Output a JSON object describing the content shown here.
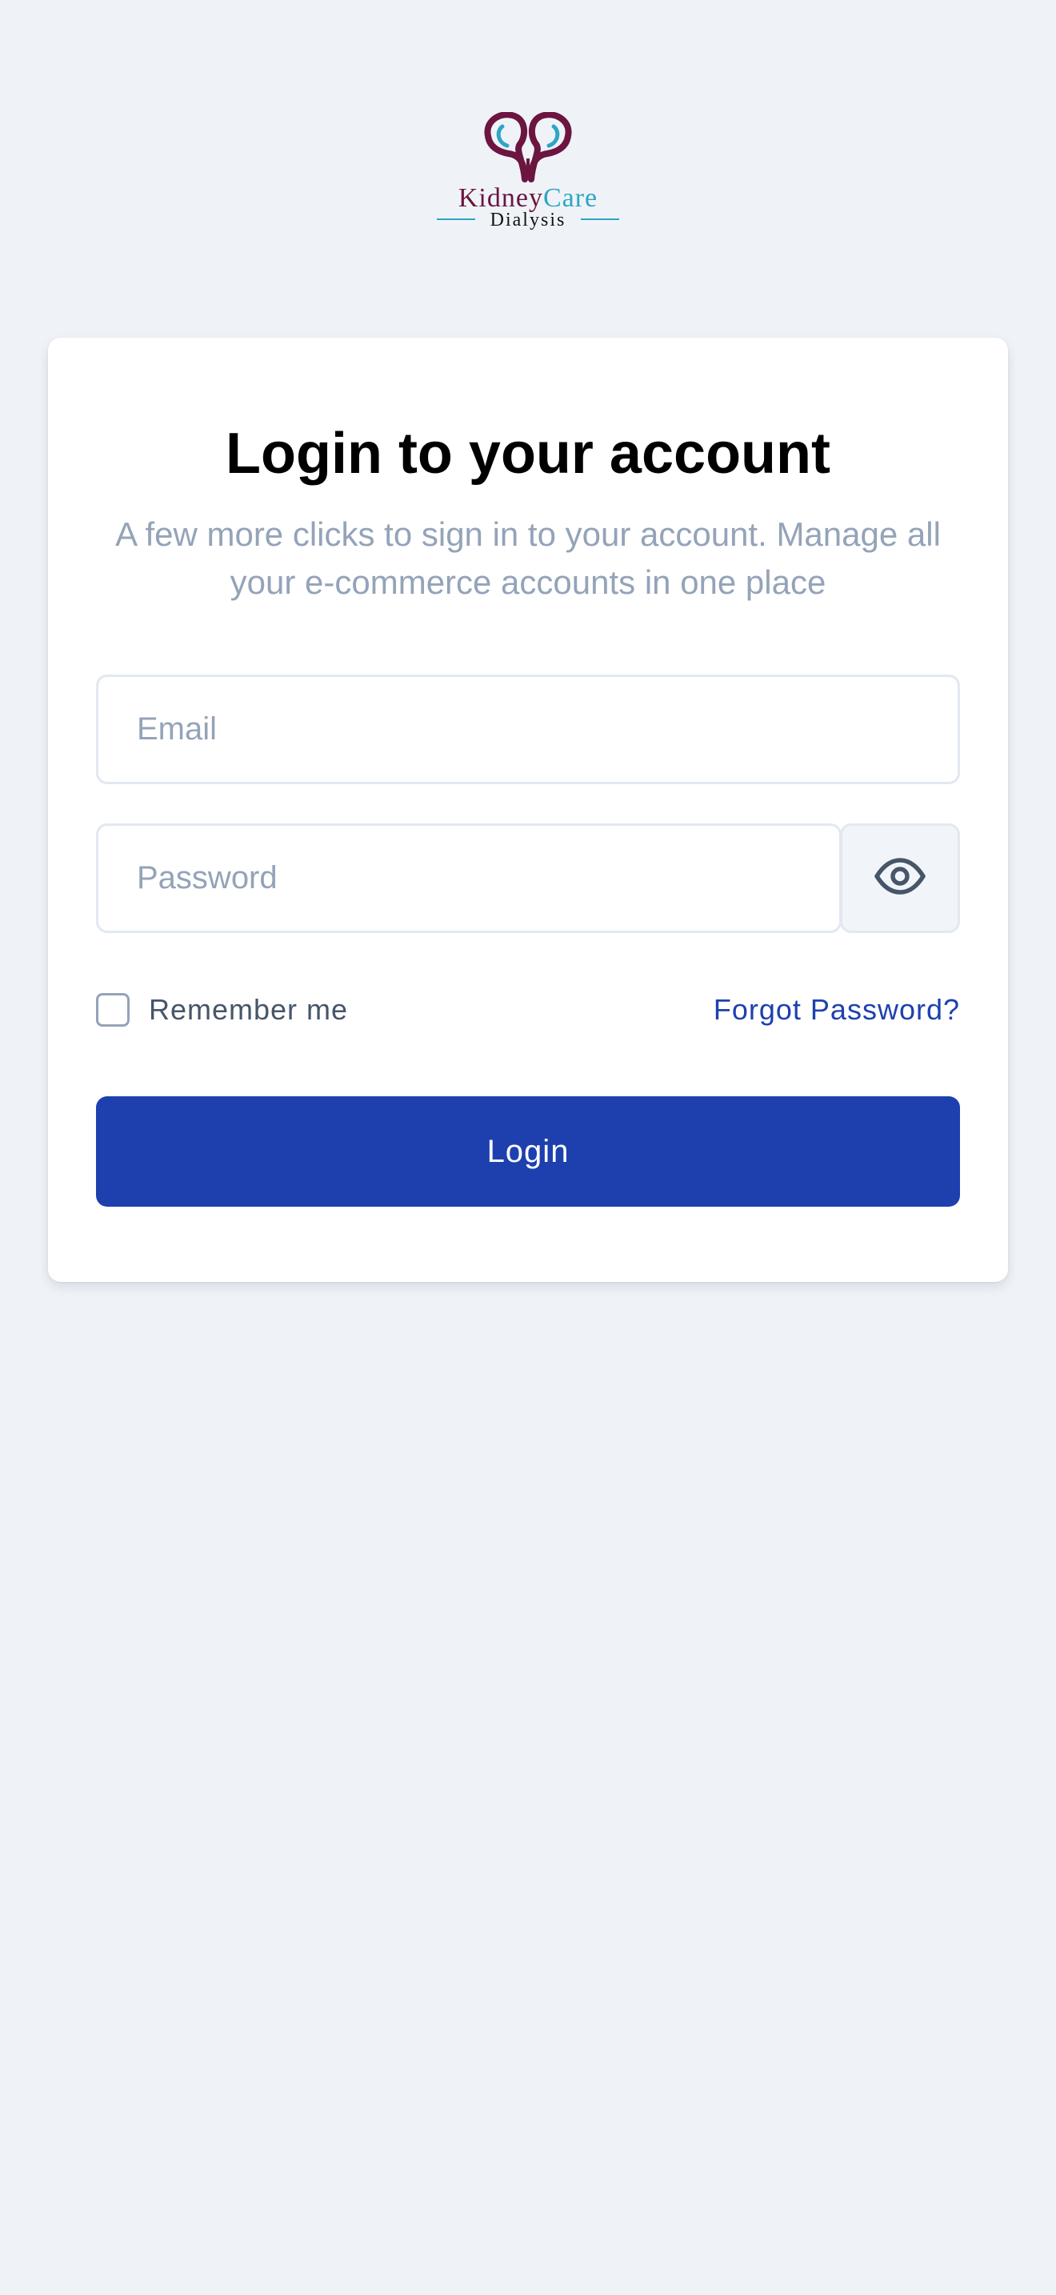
{
  "brand": {
    "name_part1": "Kidney",
    "name_part2": "Care",
    "tagline": "Dialysis",
    "colors": {
      "maroon": "#6b1540",
      "teal": "#2ea6c3"
    },
    "icon": "kidney-logo-icon"
  },
  "login": {
    "title": "Login to your account",
    "subtitle": "A few more clicks to sign in to your account. Manage all your e-commerce accounts in one place",
    "email_placeholder": "Email",
    "email_value": "",
    "password_placeholder": "Password",
    "password_value": "",
    "toggle_icon": "eye-icon",
    "remember_label": "Remember me",
    "remember_checked": false,
    "forgot_label": "Forgot Password?",
    "submit_label": "Login"
  },
  "colors": {
    "background": "#eff3f8",
    "card": "#ffffff",
    "accent": "#1e40af",
    "muted_text": "#94a3b8"
  }
}
